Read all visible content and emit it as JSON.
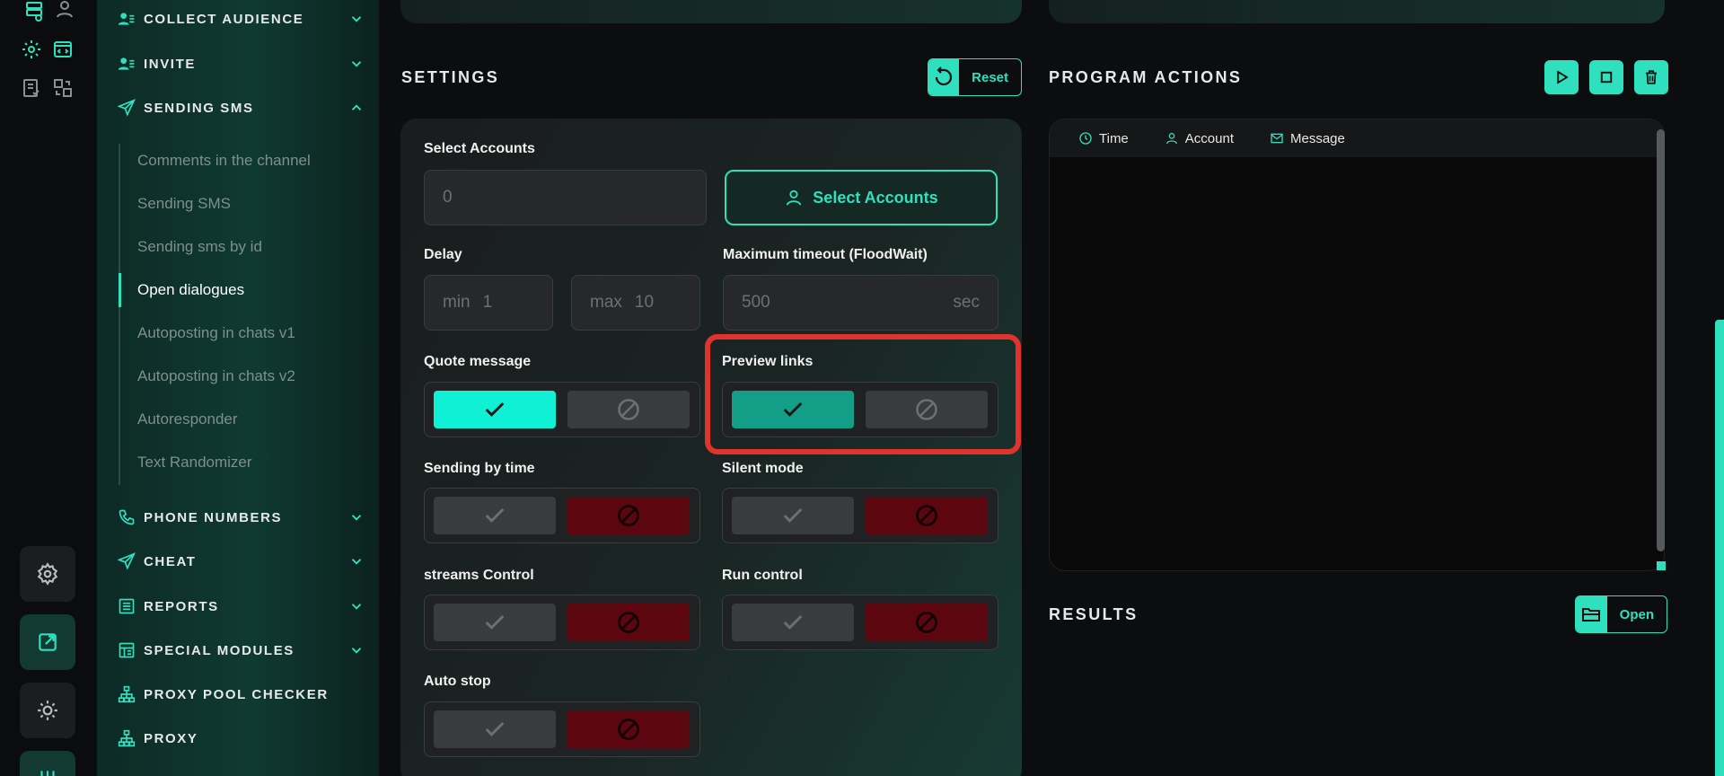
{
  "sidebar": {
    "groups": [
      {
        "label": "COLLECT AUDIENCE",
        "icon": "users-icon"
      },
      {
        "label": "INVITE",
        "icon": "users-icon"
      },
      {
        "label": "SENDING SMS",
        "icon": "paper-plane-icon"
      },
      {
        "label": "PHONE NUMBERS",
        "icon": "phone-icon"
      },
      {
        "label": "CHEAT",
        "icon": "paper-plane-icon"
      },
      {
        "label": "REPORTS",
        "icon": "report-icon"
      },
      {
        "label": "SPECIAL MODULES",
        "icon": "modules-icon"
      },
      {
        "label": "PROXY POOL CHECKER",
        "icon": "network-icon"
      },
      {
        "label": "PROXY",
        "icon": "network-icon"
      }
    ],
    "sub_items": [
      "Comments in the channel",
      "Sending SMS",
      "Sending sms by id",
      "Open dialogues",
      "Autoposting in chats v1",
      "Autoposting in chats v2",
      "Autoresponder",
      "Text Randomizer"
    ],
    "active_sub_item": "Open dialogues"
  },
  "settings": {
    "title": "SETTINGS",
    "reset_label": "Reset",
    "select_accounts_label": "Select Accounts",
    "accounts_value": "0",
    "select_accounts_button": "Select Accounts",
    "delay_label": "Delay",
    "delay_min_label": "min",
    "delay_min_value": "1",
    "delay_max_label": "max",
    "delay_max_value": "10",
    "timeout_label": "Maximum timeout (FloodWait)",
    "timeout_value": "500",
    "timeout_unit": "sec",
    "quote_message_label": "Quote message",
    "preview_links_label": "Preview links",
    "sending_by_time_label": "Sending by time",
    "silent_mode_label": "Silent mode",
    "streams_control_label": "streams Control",
    "run_control_label": "Run control",
    "auto_stop_label": "Auto stop"
  },
  "program_actions": {
    "title": "PROGRAM ACTIONS",
    "columns": [
      "Time",
      "Account",
      "Message"
    ]
  },
  "results": {
    "title": "RESULTS",
    "open_label": "Open"
  },
  "colors": {
    "accent": "#2fe0bf",
    "toggle_on": "#0ff0d4",
    "toggle_off_red": "#5c0610",
    "highlight": "#e0332e"
  }
}
